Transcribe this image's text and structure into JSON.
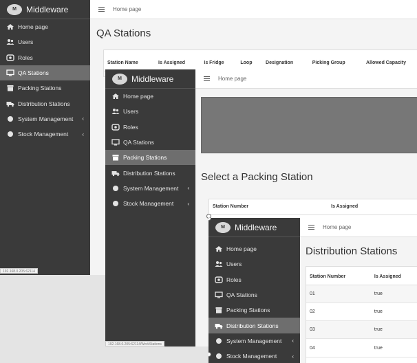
{
  "app": {
    "brand": "Middleware",
    "logo_text": "M",
    "breadcrumb": "Home page"
  },
  "nav": [
    {
      "label": "Home page",
      "icon": "home-icon"
    },
    {
      "label": "Users",
      "icon": "users-icon"
    },
    {
      "label": "Roles",
      "icon": "roles-icon"
    },
    {
      "label": "QA Stations",
      "icon": "monitor-icon"
    },
    {
      "label": "Packing Stations",
      "icon": "box-icon"
    },
    {
      "label": "Distribution Stations",
      "icon": "truck-icon"
    },
    {
      "label": "System Management",
      "icon": "circle-icon",
      "has_children": true,
      "chevron": "‹"
    },
    {
      "label": "Stock Management",
      "icon": "circle-icon",
      "has_children": true,
      "chevron": "‹"
    }
  ],
  "win1": {
    "title": "QA Stations",
    "active": "QA Stations",
    "status": "192.168.0.205:62114",
    "columns": [
      "Station Name",
      "Is Assigned",
      "Is Fridge",
      "Loop",
      "Designation",
      "Picking Group",
      "Allowed Capacity"
    ]
  },
  "win2": {
    "title": "Select a Packing Station",
    "active": "Packing Stations",
    "status": "192.168.0.205:62114/WorkStations",
    "columns": [
      "Station Number",
      "Is Assigned"
    ]
  },
  "win3": {
    "title": "Distribution Stations",
    "active": "Distribution Stations",
    "columns": [
      "Station Number",
      "Is Assigned"
    ],
    "rows": [
      [
        "01",
        "true"
      ],
      [
        "02",
        "true"
      ],
      [
        "03",
        "true"
      ],
      [
        "04",
        "true"
      ]
    ]
  },
  "colors": {
    "sidebar": "#3a3a3a",
    "active": "#6e6e6e",
    "banner": "#777777"
  }
}
